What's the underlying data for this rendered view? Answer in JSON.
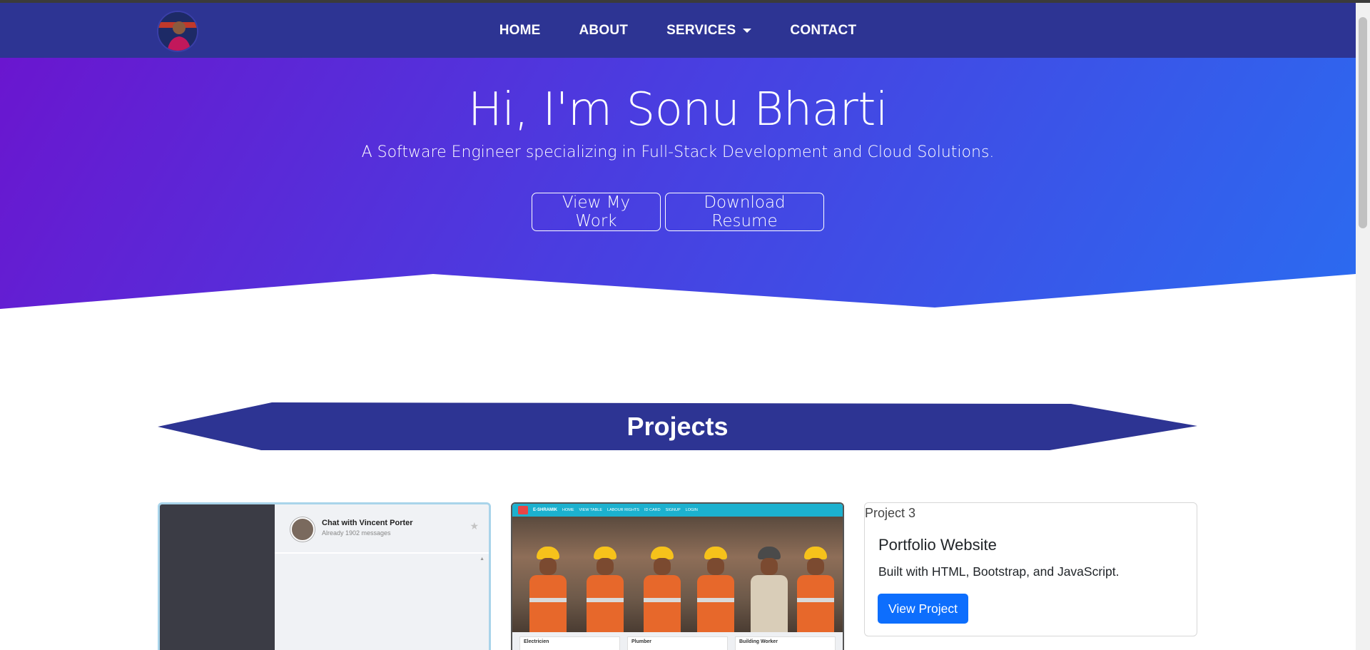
{
  "nav": {
    "links": [
      {
        "label": "HOME"
      },
      {
        "label": "ABOUT"
      },
      {
        "label": "SERVICES"
      },
      {
        "label": "CONTACT"
      }
    ]
  },
  "hero": {
    "title": "Hi, I'm Sonu Bharti",
    "subtitle": "A Software Engineer specializing in Full-Stack Development and Cloud Solutions.",
    "buttons": {
      "work": "View My Work",
      "resume": "Download Resume"
    }
  },
  "projects": {
    "heading": "Projects",
    "cards": [
      {
        "chat_name": "Chat with Vincent Porter",
        "chat_count": "Already 1902 messages"
      },
      {
        "site_brand": "E-SHRAMIK",
        "site_nav": [
          "HOME",
          "VIEW TABLE",
          "LABOUR RIGHTS",
          "ID CARD",
          "SIGNUP",
          "LOGIN"
        ],
        "tiles": [
          "Electricien",
          "Plumber",
          "Building Worker"
        ]
      },
      {
        "image_alt": "Project 3",
        "title": "Portfolio Website",
        "text": "Built with HTML, Bootstrap, and JavaScript.",
        "button": "View Project"
      }
    ]
  },
  "colors": {
    "navbar": "#2d3493",
    "hero_start": "#6a16cf",
    "hero_end": "#2b6bf0",
    "primary_button": "#0d6efd"
  }
}
